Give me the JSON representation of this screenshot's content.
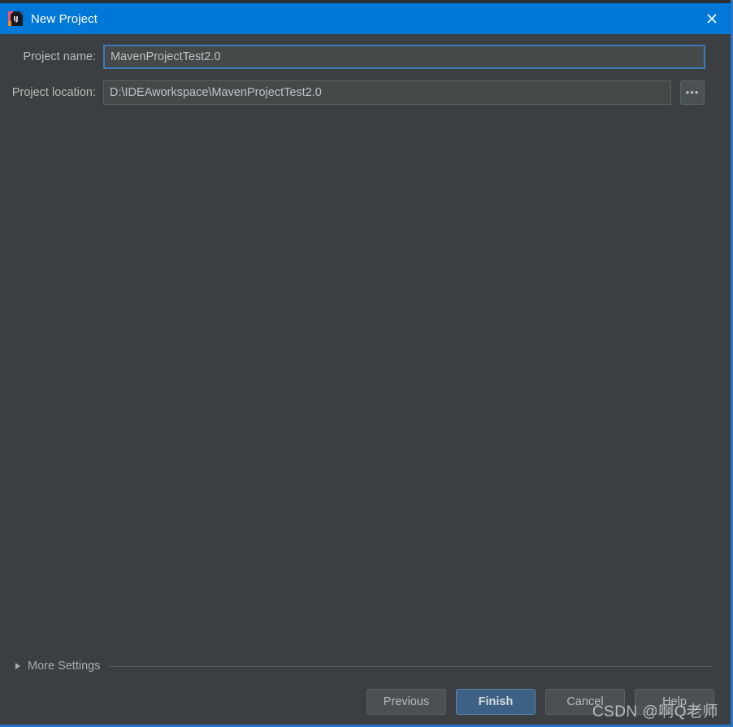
{
  "window": {
    "title": "New Project",
    "app_icon": "intellij-idea-icon",
    "close_label": "✕",
    "accent_color": "#0078d7",
    "frame_color": "#2a74c4",
    "background_color": "#3c3f41"
  },
  "form": {
    "project_name": {
      "label": "Project name:",
      "value": "MavenProjectTest2.0",
      "placeholder": "",
      "focused": true,
      "focus_color": "#3c79b8"
    },
    "project_location": {
      "label": "Project location:",
      "value": "D:\\IDEAworkspace\\MavenProjectTest2.0",
      "placeholder": "",
      "focused": false,
      "browse_label": "•••",
      "browse_icon": "ellipsis-icon"
    }
  },
  "more_settings": {
    "label": "More Settings",
    "expanded": false,
    "arrow_icon": "chevron-right-icon"
  },
  "buttons": {
    "previous": "Previous",
    "finish": "Finish",
    "cancel": "Cancel",
    "help": "Help",
    "primary": "Finish",
    "primary_color": "#3d6185"
  },
  "watermark": {
    "text": "CSDN @啊Q老师"
  }
}
